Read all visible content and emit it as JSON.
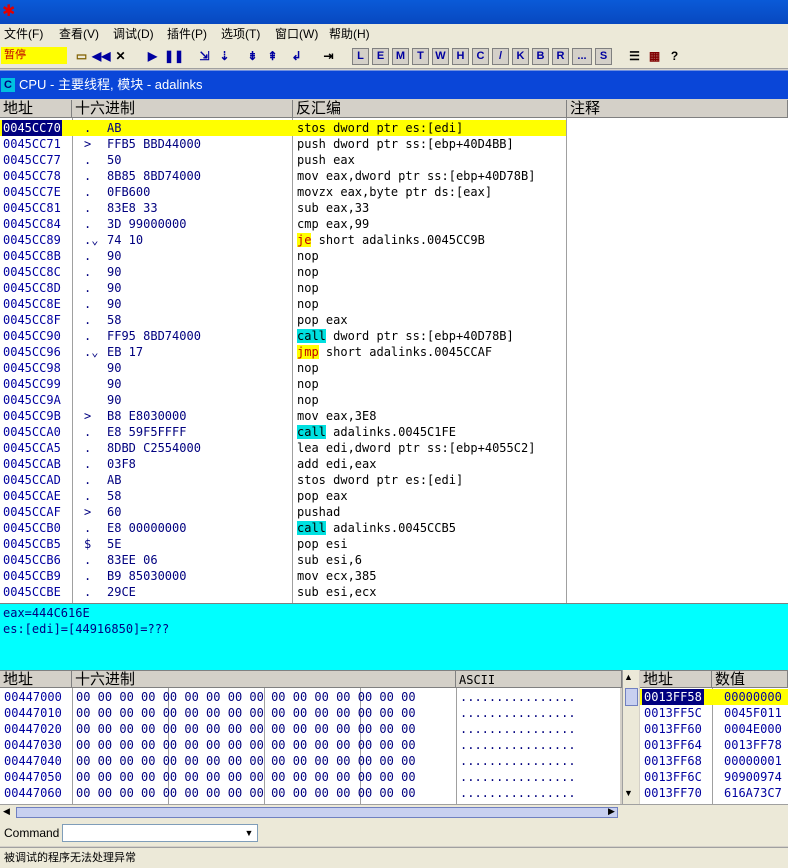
{
  "menu": [
    "文件(F)",
    "查看(V)",
    "调试(D)",
    "插件(P)",
    "选项(T)",
    "窗口(W)",
    "帮助(H)"
  ],
  "toolbar": {
    "status": "暂停",
    "letter_buttons": [
      "L",
      "E",
      "M",
      "T",
      "W",
      "H",
      "C",
      "/",
      "K",
      "B",
      "R",
      "...",
      "S"
    ]
  },
  "cpu_window": {
    "icon_letter": "C",
    "title": "CPU - 主要线程, 模块 - adalinks"
  },
  "disasm": {
    "headers": [
      "地址",
      "十六进制",
      "反汇编",
      "注释"
    ],
    "rows": [
      {
        "addr": "0045CC70",
        "mark": ".",
        "hex": "AB",
        "dis": "stos dword ptr es:[edi]",
        "sel": true
      },
      {
        "addr": "0045CC71",
        "mark": ">",
        "hex": "FFB5 BBD44000",
        "dis": "push dword ptr ss:[ebp+40D4BB]"
      },
      {
        "addr": "0045CC77",
        "mark": ".",
        "hex": "50",
        "dis": "push eax"
      },
      {
        "addr": "0045CC78",
        "mark": ".",
        "hex": "8B85 8BD74000",
        "dis": "mov eax,dword ptr ss:[ebp+40D78B]"
      },
      {
        "addr": "0045CC7E",
        "mark": ".",
        "hex": "0FB600",
        "dis": "movzx eax,byte ptr ds:[eax]"
      },
      {
        "addr": "0045CC81",
        "mark": ".",
        "hex": "83E8 33",
        "dis": "sub eax,33"
      },
      {
        "addr": "0045CC84",
        "mark": ".",
        "hex": "3D 99000000",
        "dis": "cmp eax,99"
      },
      {
        "addr": "0045CC89",
        "mark": ".⌄",
        "hex": "74 10",
        "kw": "je",
        "kwclass": "jmp",
        "dis": " short adalinks.0045CC9B"
      },
      {
        "addr": "0045CC8B",
        "mark": ".",
        "hex": "90",
        "dis": "nop"
      },
      {
        "addr": "0045CC8C",
        "mark": ".",
        "hex": "90",
        "dis": "nop"
      },
      {
        "addr": "0045CC8D",
        "mark": ".",
        "hex": "90",
        "dis": "nop"
      },
      {
        "addr": "0045CC8E",
        "mark": ".",
        "hex": "90",
        "dis": "nop"
      },
      {
        "addr": "0045CC8F",
        "mark": ".",
        "hex": "58",
        "dis": "pop eax"
      },
      {
        "addr": "0045CC90",
        "mark": ".",
        "hex": "FF95 8BD74000",
        "kw": "call",
        "kwclass": "call",
        "dis": " dword ptr ss:[ebp+40D78B]"
      },
      {
        "addr": "0045CC96",
        "mark": ".⌄",
        "hex": "EB 17",
        "kw": "jmp",
        "kwclass": "jmp",
        "dis": " short adalinks.0045CCAF"
      },
      {
        "addr": "0045CC98",
        "mark": "",
        "hex": "90",
        "dis": "nop"
      },
      {
        "addr": "0045CC99",
        "mark": "",
        "hex": "90",
        "dis": "nop"
      },
      {
        "addr": "0045CC9A",
        "mark": "",
        "hex": "90",
        "dis": "nop"
      },
      {
        "addr": "0045CC9B",
        "mark": ">",
        "hex": "B8 E8030000",
        "dis": "mov eax,3E8"
      },
      {
        "addr": "0045CCA0",
        "mark": ".",
        "hex": "E8 59F5FFFF",
        "kw": "call",
        "kwclass": "call",
        "dis": " adalinks.0045C1FE"
      },
      {
        "addr": "0045CCA5",
        "mark": ".",
        "hex": "8DBD C2554000",
        "dis": "lea edi,dword ptr ss:[ebp+4055C2]"
      },
      {
        "addr": "0045CCAB",
        "mark": ".",
        "hex": "03F8",
        "dis": "add edi,eax"
      },
      {
        "addr": "0045CCAD",
        "mark": ".",
        "hex": "AB",
        "dis": "stos dword ptr es:[edi]"
      },
      {
        "addr": "0045CCAE",
        "mark": ".",
        "hex": "58",
        "dis": "pop eax"
      },
      {
        "addr": "0045CCAF",
        "mark": ">",
        "hex": "60",
        "dis": "pushad"
      },
      {
        "addr": "0045CCB0",
        "mark": ".",
        "hex": "E8 00000000",
        "kw": "call",
        "kwclass": "call",
        "dis": " adalinks.0045CCB5"
      },
      {
        "addr": "0045CCB5",
        "mark": "$",
        "hex": "5E",
        "dis": "pop esi"
      },
      {
        "addr": "0045CCB6",
        "mark": ".",
        "hex": "83EE 06",
        "dis": "sub esi,6"
      },
      {
        "addr": "0045CCB9",
        "mark": ".",
        "hex": "B9 85030000",
        "dis": "mov ecx,385"
      },
      {
        "addr": "0045CCBE",
        "mark": ".",
        "hex": "29CE",
        "dis": "sub esi,ecx"
      }
    ]
  },
  "info": [
    "eax=444C616E",
    "es:[edi]=[44916850]=???"
  ],
  "dump": {
    "headers": [
      "地址",
      "十六进制",
      "ASCII"
    ],
    "rows": [
      {
        "addr": "00447000",
        "hex": "00 00 00 00 00 00 00 00 00 00 00 00 00 00 00 00",
        "ascii": "................"
      },
      {
        "addr": "00447010",
        "hex": "00 00 00 00 00 00 00 00 00 00 00 00 00 00 00 00",
        "ascii": "................"
      },
      {
        "addr": "00447020",
        "hex": "00 00 00 00 00 00 00 00 00 00 00 00 00 00 00 00",
        "ascii": "................"
      },
      {
        "addr": "00447030",
        "hex": "00 00 00 00 00 00 00 00 00 00 00 00 00 00 00 00",
        "ascii": "................"
      },
      {
        "addr": "00447040",
        "hex": "00 00 00 00 00 00 00 00 00 00 00 00 00 00 00 00",
        "ascii": "................"
      },
      {
        "addr": "00447050",
        "hex": "00 00 00 00 00 00 00 00 00 00 00 00 00 00 00 00",
        "ascii": "................"
      },
      {
        "addr": "00447060",
        "hex": "00 00 00 00 00 00 00 00 00 00 00 00 00 00 00 00",
        "ascii": "................"
      }
    ]
  },
  "stack": {
    "headers": [
      "地址",
      "数值"
    ],
    "rows": [
      {
        "addr": "0013FF58",
        "val": "00000000",
        "sel": true
      },
      {
        "addr": "0013FF5C",
        "val": "0045F011"
      },
      {
        "addr": "0013FF60",
        "val": "0004E000"
      },
      {
        "addr": "0013FF64",
        "val": "0013FF78"
      },
      {
        "addr": "0013FF68",
        "val": "00000001"
      },
      {
        "addr": "0013FF6C",
        "val": "90900974"
      },
      {
        "addr": "0013FF70",
        "val": "616A73C7"
      }
    ]
  },
  "command": {
    "label": "Command :",
    "value": ""
  },
  "status": "被调试的程序无法处理异常",
  "colors": {
    "selection": "#ffff00",
    "info_bg": "#00ffff",
    "call_bg": "#00e0e0",
    "title_bg": "#0a46d8"
  }
}
